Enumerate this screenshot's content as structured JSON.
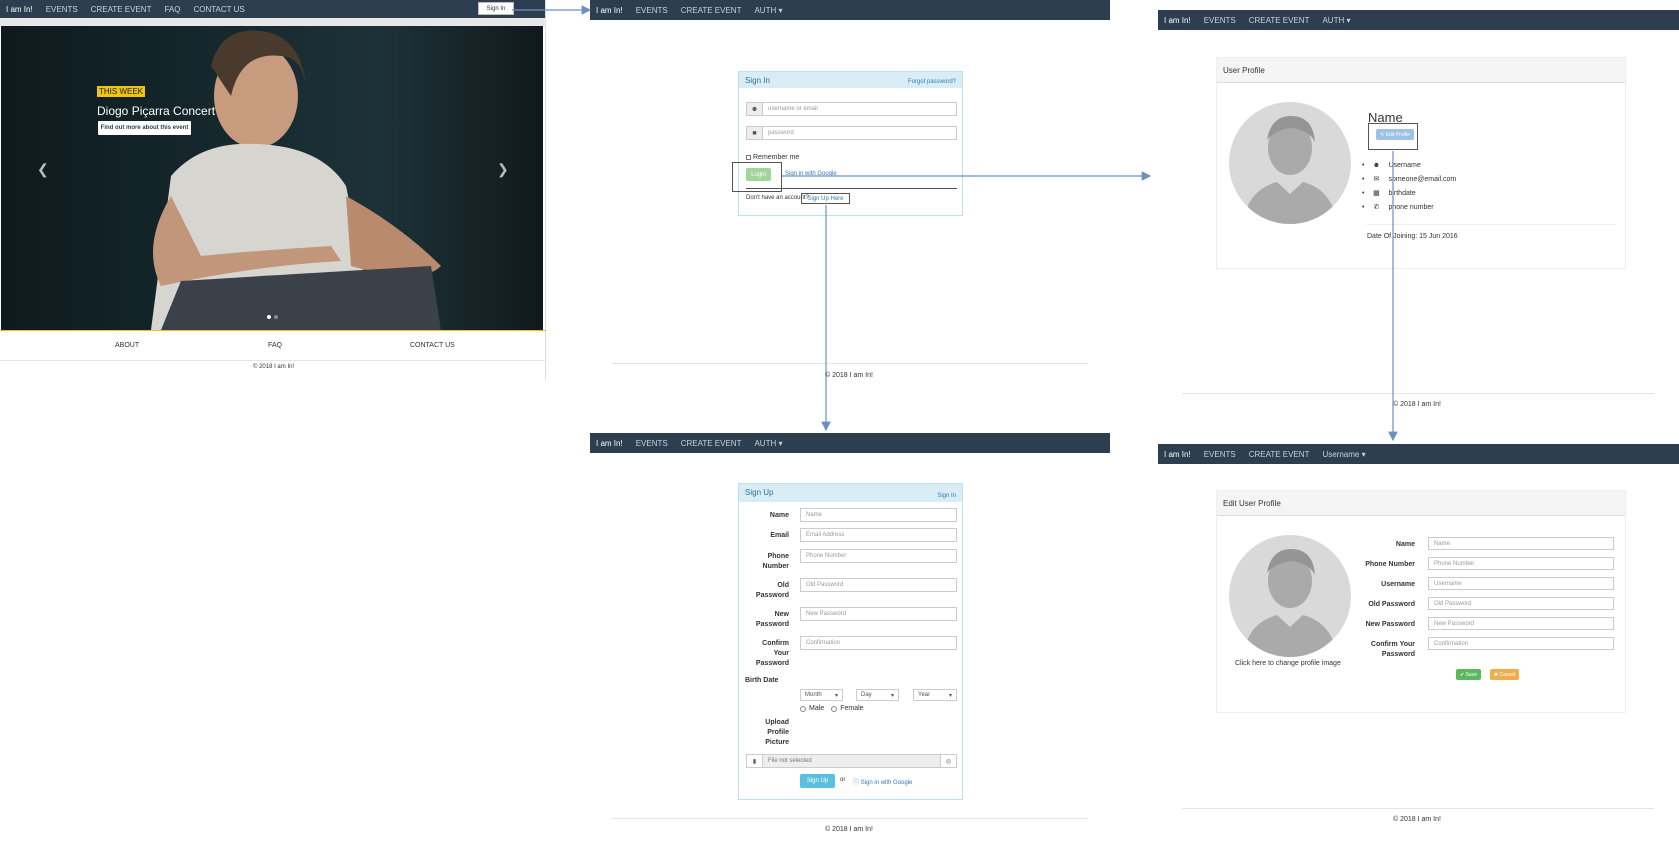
{
  "home": {
    "nav": {
      "brand": "I am In!",
      "items": [
        "EVENTS",
        "CREATE EVENT",
        "FAQ",
        "CONTACT US"
      ],
      "signin": "Sign In"
    },
    "hero": {
      "badge": "THIS WEEK",
      "title": "Diogo Piçarra Concert",
      "button": "Find out more about this event"
    },
    "footer": {
      "links": [
        "ABOUT",
        "FAQ",
        "CONTACT US"
      ],
      "copyright": "© 2018 I am In!"
    }
  },
  "signin": {
    "nav": {
      "brand": "I am In!",
      "items": [
        "EVENTS",
        "CREATE EVENT",
        "AUTH ▾"
      ]
    },
    "title": "Sign In",
    "forgot": "Forgot password?",
    "username_placeholder": "username or email",
    "password_placeholder": "password",
    "remember": "Remember me",
    "login": "Login",
    "google": "Sign in with Google",
    "no_account": "Don't have an account?",
    "signup_link": "Sign Up Here",
    "copyright": "© 2018 I am In!"
  },
  "profile": {
    "nav": {
      "brand": "I am In!",
      "items": [
        "EVENTS",
        "CREATE EVENT",
        "AUTH ▾"
      ]
    },
    "title": "User Profile",
    "name": "Name",
    "edit": "✎ Edit Profile",
    "fields": [
      "Username",
      "someone@email.com",
      "birthdate",
      "phone number"
    ],
    "joined_label": "Date Of Joining:",
    "joined_value": "15 Jun 2016",
    "copyright": "© 2018 I am In!"
  },
  "signup": {
    "nav": {
      "brand": "I am In!",
      "items": [
        "EVENTS",
        "CREATE EVENT",
        "AUTH ▾"
      ]
    },
    "title": "Sign Up",
    "signin_link": "Sign In",
    "rows": [
      {
        "label": "Name",
        "placeholder": "Name"
      },
      {
        "label": "Email",
        "placeholder": "Email Address"
      },
      {
        "label": "Phone Number",
        "placeholder": "Phone Number"
      },
      {
        "label": "Old Password",
        "placeholder": "Old Password"
      },
      {
        "label": "New Password",
        "placeholder": "New Password"
      },
      {
        "label": "Confirm Your Password",
        "placeholder": "Confirmation"
      }
    ],
    "birth_label": "Birth Date",
    "month": "Month",
    "day": "Day",
    "year": "Year",
    "male": "Male",
    "female": "Female",
    "upload_label": "Upload Profile Picture",
    "file_text": "File not selected",
    "signup_button": "Sign Up",
    "or": "or",
    "google": "Sign in with Google",
    "copyright": "© 2018 I am In!"
  },
  "edit": {
    "nav": {
      "brand": "I am In!",
      "items": [
        "EVENTS",
        "CREATE EVENT",
        "Username ▾"
      ]
    },
    "title": "Edit User Profile",
    "change_image": "Click here to change profile image",
    "rows": [
      {
        "label": "Name",
        "placeholder": "Name"
      },
      {
        "label": "Phone Number",
        "placeholder": "Phone Number"
      },
      {
        "label": "Username",
        "placeholder": "Username"
      },
      {
        "label": "Old Password",
        "placeholder": "Old Password"
      },
      {
        "label": "New Password",
        "placeholder": "New Password"
      },
      {
        "label": "Confirm Your Password",
        "placeholder": "Confirmation"
      }
    ],
    "save": "✔ Save",
    "cancel": "✖ Cancel",
    "copyright": "© 2018 I am In!"
  },
  "colors": {
    "navbar": "#2c3e50",
    "accent": "#f1c40f",
    "info": "#5bc0de",
    "success": "#5cb85c",
    "warning": "#f0ad4e",
    "arrow": "#6b8fbf"
  }
}
